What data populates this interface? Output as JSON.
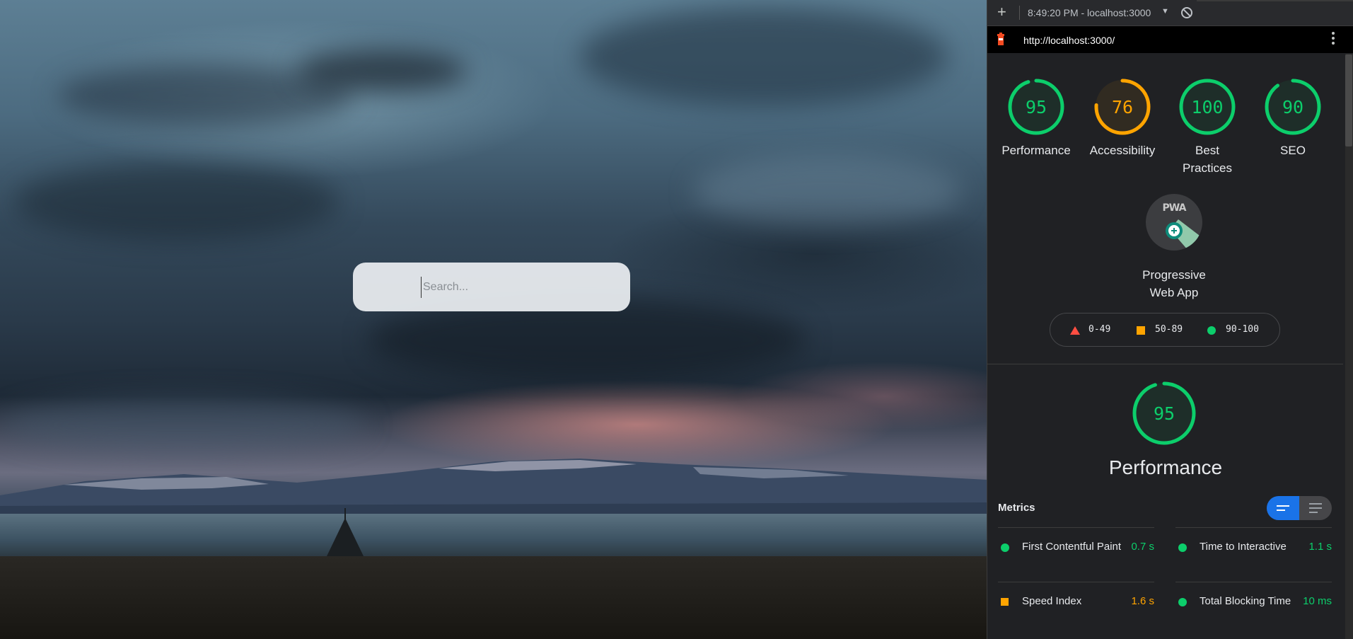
{
  "search": {
    "placeholder": "Search..."
  },
  "toolbar": {
    "add_label": "+",
    "session": "8:49:20 PM - localhost:3000",
    "caret": "▼"
  },
  "report": {
    "url": "http://localhost:3000/"
  },
  "gauges": [
    {
      "score": "95",
      "label": "Performance",
      "fraction": 0.95,
      "color": "#0cce6b"
    },
    {
      "score": "76",
      "label": "Accessibility",
      "fraction": 0.76,
      "color": "#ffa400"
    },
    {
      "score": "100",
      "label": "Best Practices",
      "fraction": 1.0,
      "color": "#0cce6b"
    },
    {
      "score": "90",
      "label": "SEO",
      "fraction": 0.9,
      "color": "#0cce6b"
    }
  ],
  "pwa": {
    "badge": "PWA",
    "label": "Progressive Web App"
  },
  "legend": [
    {
      "range": "0-49",
      "color": "#ff4e42",
      "shape": "triangle"
    },
    {
      "range": "50-89",
      "color": "#ffa400",
      "shape": "square"
    },
    {
      "range": "90-100",
      "color": "#0cce6b",
      "shape": "circle"
    }
  ],
  "performance": {
    "score": "95",
    "fraction": 0.95,
    "title": "Performance",
    "color": "#0cce6b"
  },
  "metrics": {
    "heading": "Metrics",
    "items": [
      {
        "name": "First Contentful Paint",
        "value": "0.7 s",
        "status": "pass",
        "color": "#0cce6b"
      },
      {
        "name": "Time to Interactive",
        "value": "1.1 s",
        "status": "pass",
        "color": "#0cce6b"
      },
      {
        "name": "Speed Index",
        "value": "1.6 s",
        "status": "average",
        "color": "#ffa400"
      },
      {
        "name": "Total Blocking Time",
        "value": "10 ms",
        "status": "pass",
        "color": "#0cce6b"
      }
    ]
  }
}
